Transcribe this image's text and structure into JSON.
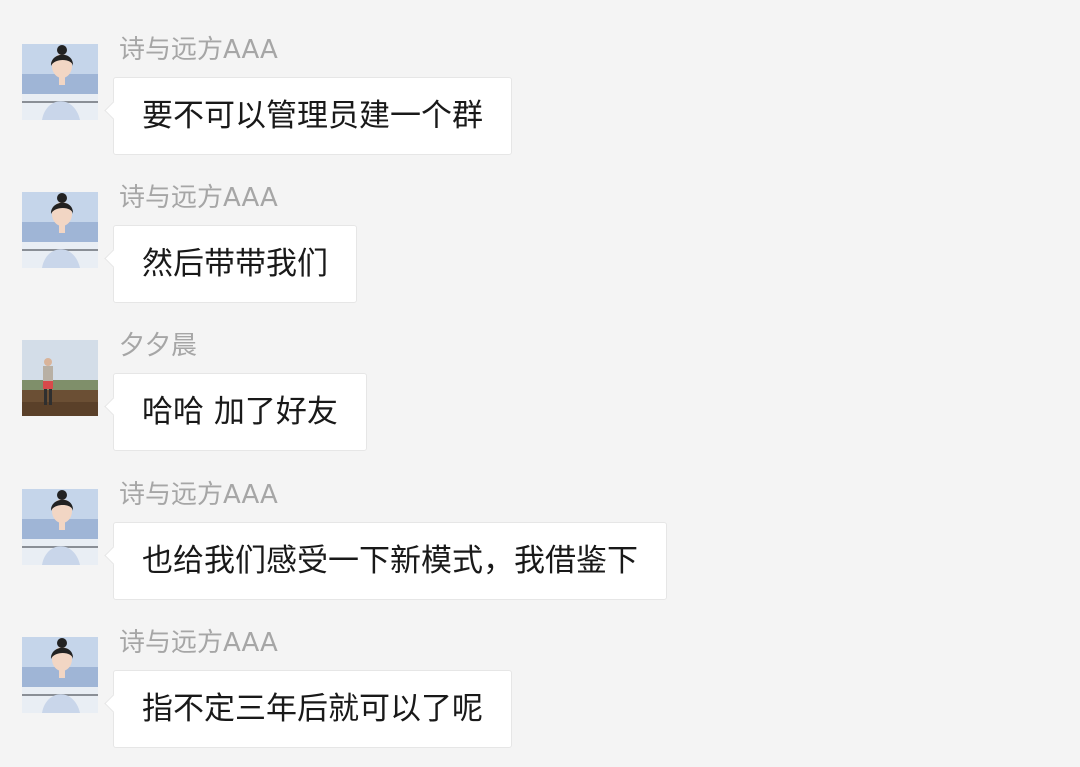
{
  "messages": [
    {
      "sender": "诗与远方AAA",
      "avatar": "girl-portrait-avatar",
      "text": "要不可以管理员建一个群"
    },
    {
      "sender": "诗与远方AAA",
      "avatar": "girl-portrait-avatar",
      "text": "然后带带我们"
    },
    {
      "sender": "夕夕晨",
      "avatar": "man-walking-field-avatar",
      "text": "哈哈 加了好友"
    },
    {
      "sender": "诗与远方AAA",
      "avatar": "girl-portrait-avatar",
      "text": "也给我们感受一下新模式，我借鉴下"
    },
    {
      "sender": "诗与远方AAA",
      "avatar": "girl-portrait-avatar",
      "text": "指不定三年后就可以了呢"
    }
  ],
  "colors": {
    "background": "#f4f4f4",
    "bubble": "#ffffff",
    "sender_name": "#a6a6a6",
    "message_text": "#191919"
  }
}
